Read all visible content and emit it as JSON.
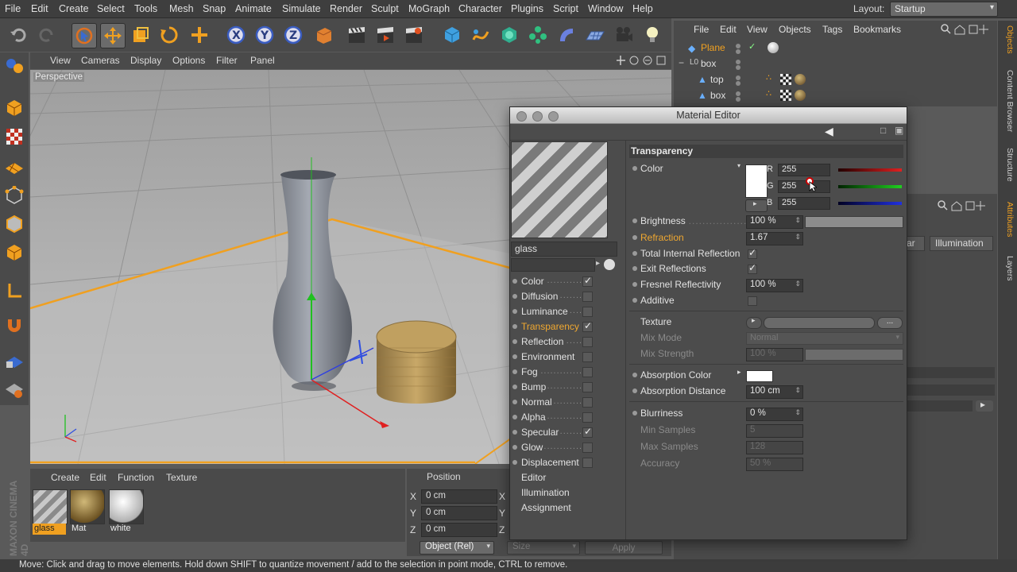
{
  "app": {
    "menubar": [
      "File",
      "Edit",
      "Create",
      "Select",
      "Tools",
      "Mesh",
      "Snap",
      "Animate",
      "Simulate",
      "Render",
      "Sculpt",
      "MoGraph",
      "Character",
      "Plugins",
      "Script",
      "Window",
      "Help"
    ],
    "layout_label": "Layout:",
    "layout_value": "Startup",
    "status": "Move: Click and drag to move elements. Hold down SHIFT to quantize movement / add to the selection in point mode, CTRL to remove.",
    "brand": "MAXON CINEMA 4D"
  },
  "viewport": {
    "menu": [
      "View",
      "Cameras",
      "Display",
      "Options",
      "Filter",
      "Panel"
    ],
    "label": "Perspective"
  },
  "material_manager": {
    "menu": [
      "Create",
      "Edit",
      "Function",
      "Texture"
    ],
    "materials": [
      {
        "name": "glass",
        "selected": true
      },
      {
        "name": "Mat",
        "selected": false
      },
      {
        "name": "white",
        "selected": false
      }
    ]
  },
  "coordinates": {
    "title": "Position",
    "rows": [
      {
        "axis": "X",
        "value": "0 cm",
        "axis2": "X"
      },
      {
        "axis": "Y",
        "value": "0 cm",
        "axis2": "Y"
      },
      {
        "axis": "Z",
        "value": "0 cm",
        "axis2": "Z"
      }
    ],
    "mode": "Object (Rel)",
    "size": "Size",
    "apply": "Apply"
  },
  "object_manager": {
    "menu": [
      "File",
      "Edit",
      "View",
      "Objects",
      "Tags",
      "Bookmarks"
    ],
    "objects": [
      {
        "name": "Plane",
        "selected": true
      },
      {
        "name": "box",
        "selected": false
      },
      {
        "name": "top",
        "selected": false
      },
      {
        "name": "box",
        "selected": false
      }
    ]
  },
  "attributes": {
    "tabs_partial": [
      "ar",
      "Illumination"
    ]
  },
  "right_tabs": [
    "Objects",
    "Content Browser",
    "Structure",
    "Attributes",
    "Layers"
  ],
  "material_editor": {
    "title": "Material Editor",
    "material_name": "glass",
    "channels": [
      {
        "label": "Color",
        "checked": true,
        "active": false
      },
      {
        "label": "Diffusion",
        "checked": false,
        "active": false
      },
      {
        "label": "Luminance",
        "checked": false,
        "active": false
      },
      {
        "label": "Transparency",
        "checked": true,
        "active": true
      },
      {
        "label": "Reflection",
        "checked": false,
        "active": false
      },
      {
        "label": "Environment",
        "checked": false,
        "active": false
      },
      {
        "label": "Fog",
        "checked": false,
        "active": false
      },
      {
        "label": "Bump",
        "checked": false,
        "active": false
      },
      {
        "label": "Normal",
        "checked": false,
        "active": false
      },
      {
        "label": "Alpha",
        "checked": false,
        "active": false
      },
      {
        "label": "Specular",
        "checked": true,
        "active": false
      },
      {
        "label": "Glow",
        "checked": false,
        "active": false
      },
      {
        "label": "Displacement",
        "checked": false,
        "active": false
      }
    ],
    "extra_items": [
      "Editor",
      "Illumination",
      "Assignment"
    ],
    "section": "Transparency",
    "color": {
      "label": "Color",
      "r": "255",
      "g": "255",
      "b": "255",
      "swatch": "#ffffff"
    },
    "brightness": {
      "label": "Brightness",
      "value": "100 %"
    },
    "refraction": {
      "label": "Refraction",
      "value": "1.67"
    },
    "total_internal_reflection": {
      "label": "Total Internal Reflection",
      "checked": true
    },
    "exit_reflections": {
      "label": "Exit Reflections",
      "checked": true
    },
    "fresnel": {
      "label": "Fresnel Reflectivity",
      "value": "100 %"
    },
    "additive": {
      "label": "Additive",
      "checked": false
    },
    "texture": {
      "label": "Texture",
      "button": "..."
    },
    "mix_mode": {
      "label": "Mix Mode",
      "value": "Normal"
    },
    "mix_strength": {
      "label": "Mix Strength",
      "value": "100 %"
    },
    "absorption_color": {
      "label": "Absorption Color",
      "swatch": "#ffffff"
    },
    "absorption_distance": {
      "label": "Absorption Distance",
      "value": "100 cm"
    },
    "blurriness": {
      "label": "Blurriness",
      "value": "0 %"
    },
    "min_samples": {
      "label": "Min Samples",
      "value": "5"
    },
    "max_samples": {
      "label": "Max Samples",
      "value": "128"
    },
    "accuracy": {
      "label": "Accuracy",
      "value": "50 %"
    }
  }
}
